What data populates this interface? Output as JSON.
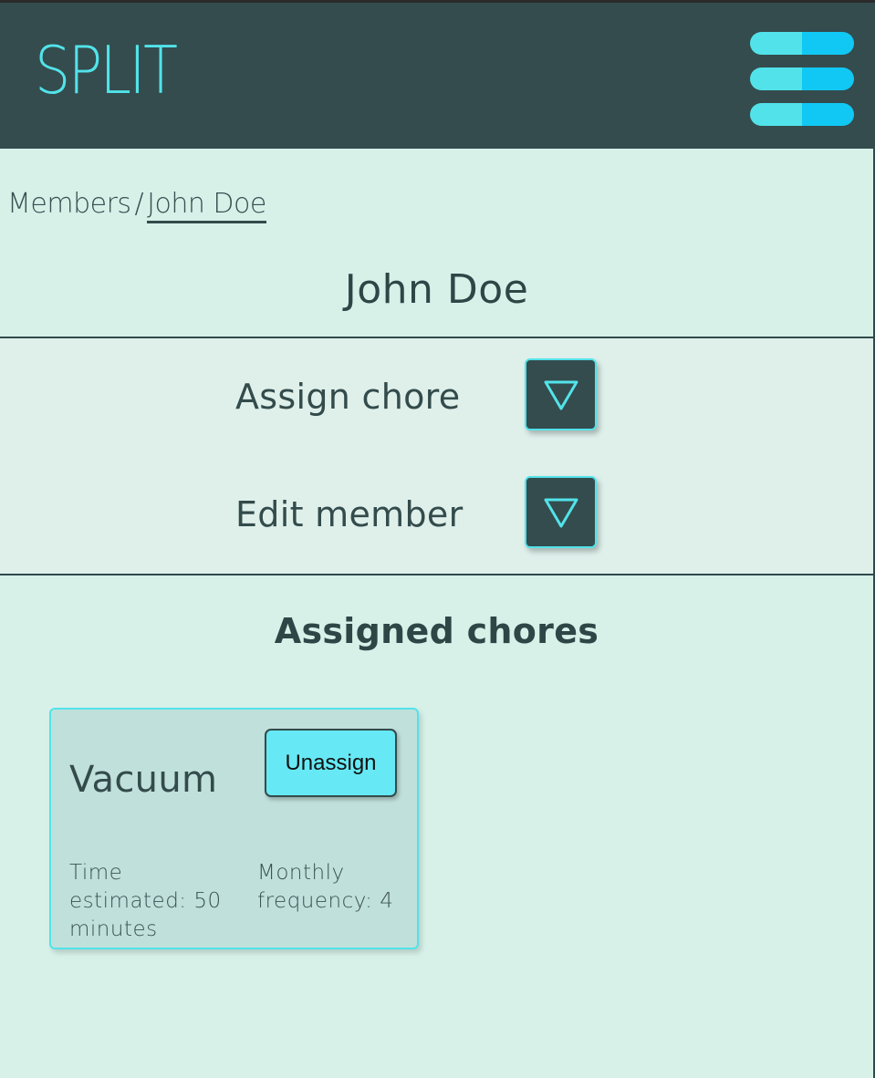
{
  "header": {
    "logo_text": "SPLIT",
    "menu_icon": "hamburger-menu-icon",
    "colors": {
      "background": "#344c4d",
      "accent": "#52e3ea",
      "accent_alt": "#11c8f4"
    }
  },
  "breadcrumb": {
    "parent": "Members",
    "separator": "/",
    "current": "John Doe"
  },
  "member": {
    "name": "John Doe"
  },
  "actions": [
    {
      "label": "Assign chore",
      "icon": "triangle-down-icon"
    },
    {
      "label": "Edit member",
      "icon": "triangle-down-icon"
    }
  ],
  "assigned_section": {
    "title": "Assigned chores",
    "chores": [
      {
        "name": "Vacuum",
        "button_label": "Unassign",
        "time_text": "Time estimated: 50 minutes",
        "frequency_text": "Monthly frequency: 4"
      }
    ]
  },
  "colors": {
    "page_background": "#d7f1e9",
    "text": "#334b4b",
    "card_background": "#c0e0dc",
    "button_background": "#66e9f4"
  }
}
